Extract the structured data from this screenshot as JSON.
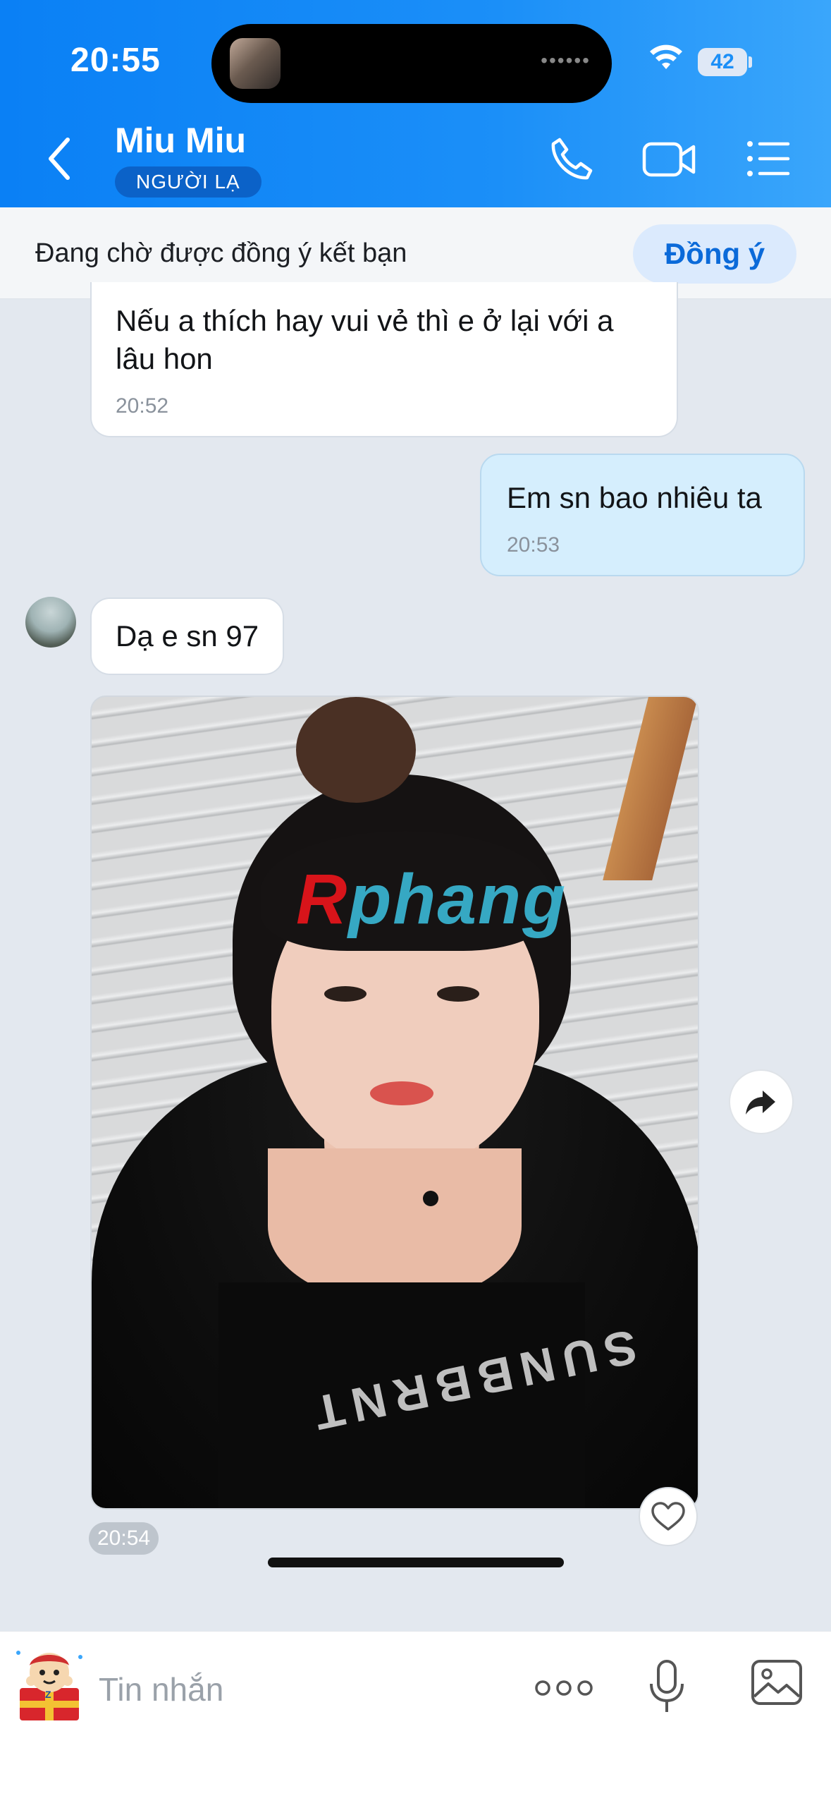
{
  "status_bar": {
    "time": "20:55",
    "battery": "42",
    "island_indicator": "••••••"
  },
  "header": {
    "contact_name": "Miu Miu",
    "badge": "NGƯỜI LẠ",
    "icons": [
      "chevron-left-icon",
      "phone-icon",
      "video-camera-icon",
      "list-menu-icon"
    ]
  },
  "request_bar": {
    "text": "Đang chờ được đồng ý kết bạn",
    "accept_label": "Đồng ý"
  },
  "messages": [
    {
      "side": "received",
      "text": "Nếu a thích hay vui vẻ thì e ở lại với a lâu hon",
      "time": "20:52"
    },
    {
      "side": "sent",
      "text": "Em sn bao nhiêu ta",
      "time": "20:53"
    },
    {
      "side": "received",
      "text": "Dạ e sn 97"
    },
    {
      "side": "received",
      "type": "image",
      "watermark": "Rphang",
      "shirt_print": "SUNBBRNT",
      "time": "20:54"
    }
  ],
  "input": {
    "placeholder": "Tin nhắn"
  },
  "colors": {
    "header_blue": "#0a80f5",
    "sent_bubble": "#d5eefd",
    "accept_text": "#0b6ad9",
    "badge_bg": "#0b62c8"
  }
}
